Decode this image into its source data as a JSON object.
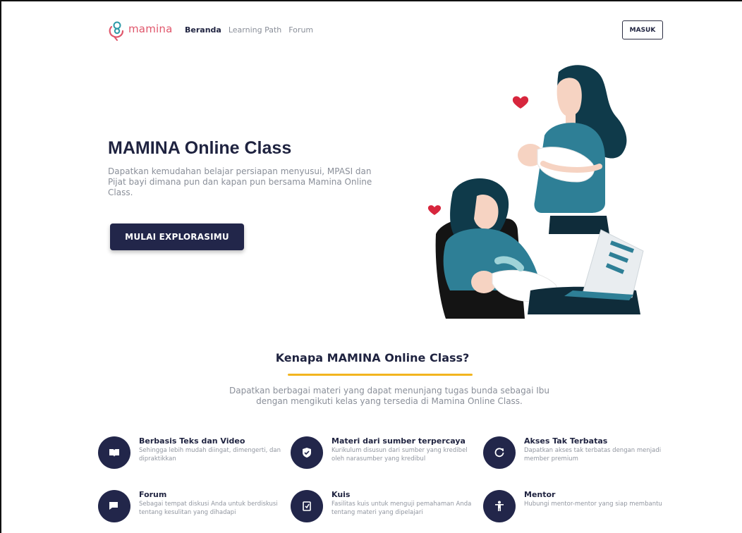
{
  "nav": {
    "logo_text": "mamina",
    "links": [
      "Beranda",
      "Learning Path",
      "Forum"
    ],
    "login_label": "MASUK"
  },
  "hero": {
    "title": "MAMINA Online Class",
    "description": "Dapatkan kemudahan belajar persiapan menyusui, MPASI dan Pijat bayi  dimana pun dan kapan pun bersama Mamina Online Class.",
    "cta_label": "MULAI EXPLORASIMU"
  },
  "why": {
    "title": "Kenapa MAMINA Online Class?",
    "description": "Dapatkan berbagai materi yang dapat menunjang tugas bunda sebagai Ibu dengan mengikuti kelas yang tersedia di Mamina Online Class.",
    "features": [
      {
        "title": "Berbasis Teks dan Video",
        "desc": "Sehingga lebih mudah diingat, dimengerti, dan dipraktikkan",
        "icon": "book-icon"
      },
      {
        "title": "Materi dari sumber terpercaya",
        "desc": "Kurikulum disusun dari sumber yang kredibel oleh narasumber yang kredibul",
        "icon": "shield-check-icon"
      },
      {
        "title": "Akses Tak Terbatas",
        "desc": "Dapatkan akses tak terbatas dengan menjadi member premium",
        "icon": "refresh-icon"
      },
      {
        "title": "Forum",
        "desc": "Sebagai tempat diskusi Anda untuk berdiskusi  tentang kesulitan yang dihadapi",
        "icon": "chat-icon"
      },
      {
        "title": "Kuis",
        "desc": "Fasilitas kuis untuk menguji pemahaman Anda tentang materi yang dipelajari",
        "icon": "quiz-icon"
      },
      {
        "title": "Mentor",
        "desc": "Hubungi mentor-mentor yang siap membantu",
        "icon": "person-icon"
      }
    ]
  },
  "colors": {
    "primary": "#22264a",
    "brand": "#e0566b",
    "accent": "#f2b51f",
    "teal": "#2e7f96"
  }
}
